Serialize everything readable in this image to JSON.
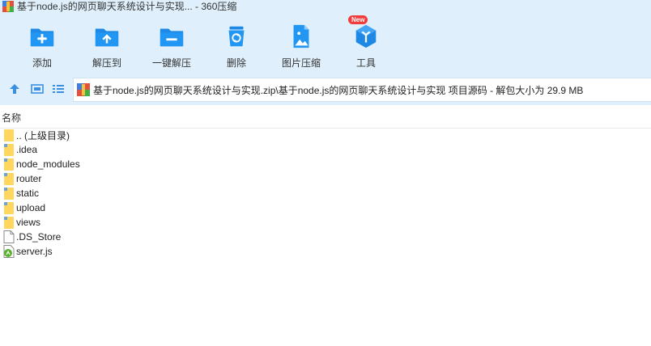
{
  "window": {
    "title": "基于node.js的网页聊天系统设计与实现... - 360压缩"
  },
  "toolbar": {
    "buttons": [
      {
        "label": "添加",
        "icon": "add-icon"
      },
      {
        "label": "解压到",
        "icon": "extract-to-icon"
      },
      {
        "label": "一键解压",
        "icon": "one-click-extract-icon"
      },
      {
        "label": "删除",
        "icon": "delete-icon"
      },
      {
        "label": "图片压缩",
        "icon": "image-compress-icon"
      },
      {
        "label": "工具",
        "icon": "tools-icon",
        "badge": "New"
      }
    ]
  },
  "nav": {
    "path": "基于node.js的网页聊天系统设计与实现.zip\\基于node.js的网页聊天系统设计与实现 项目源码 - 解包大小为 29.9 MB"
  },
  "list": {
    "column_name": "名称",
    "items": [
      {
        "name": ".. (上级目录)",
        "type": "parent"
      },
      {
        "name": ".idea",
        "type": "folder"
      },
      {
        "name": "node_modules",
        "type": "folder"
      },
      {
        "name": "router",
        "type": "folder"
      },
      {
        "name": "static",
        "type": "folder"
      },
      {
        "name": "upload",
        "type": "folder"
      },
      {
        "name": "views",
        "type": "folder"
      },
      {
        "name": ".DS_Store",
        "type": "file"
      },
      {
        "name": "server.js",
        "type": "js"
      }
    ]
  },
  "colors": {
    "toolbar_bg": "#dff0fc",
    "icon_blue": "#1e88e5",
    "folder_yellow": "#ffd75e",
    "badge_red": "#f23b3b"
  }
}
